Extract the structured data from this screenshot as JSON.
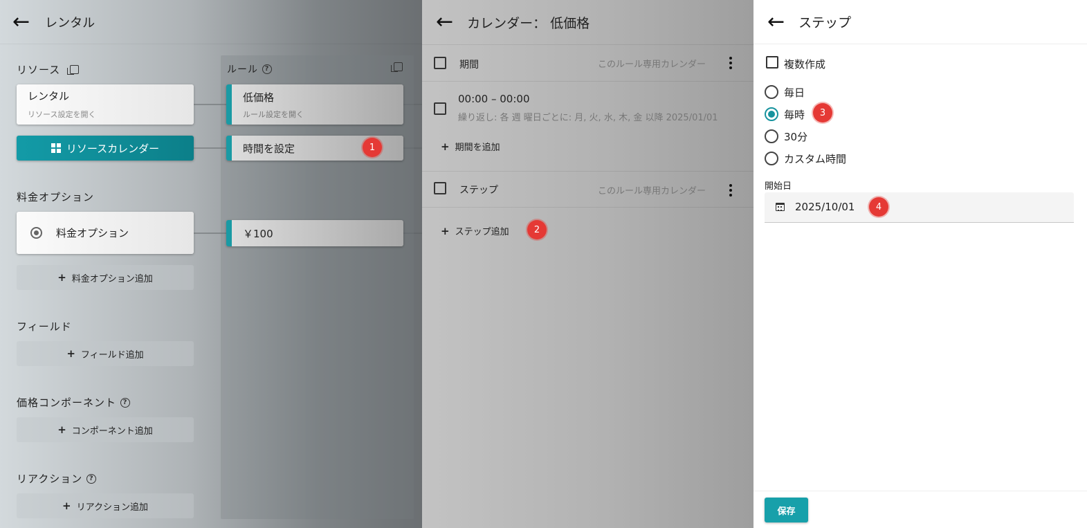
{
  "left": {
    "title": "レンタル",
    "resource_label": "リソース",
    "resource_card": {
      "title": "レンタル",
      "subtitle": "リソース設定を開く"
    },
    "resource_calendar_button": "リソースカレンダー",
    "price_option_label": "料金オプション",
    "price_option_card": "料金オプション",
    "price_option_add": "料金オプション追加",
    "field_label": "フィールド",
    "field_add": "フィールド追加",
    "component_label": "価格コンポーネント",
    "component_add": "コンポーネント追加",
    "reaction_label": "リアクション",
    "reaction_add": "リアクション追加",
    "rules_label": "ルール",
    "rule_card": {
      "title": "低価格",
      "subtitle": "ルール設定を開く"
    },
    "time_card": "時間を設定",
    "price_card": "￥100"
  },
  "middle": {
    "title": "カレンダー： 低価格",
    "period_section": {
      "label": "期間",
      "scope": "このルール専用カレンダー"
    },
    "period_item": {
      "time": "00:00 – 00:00",
      "repeat": "繰り返し: 各 週 曜日ごとに: 月, 火, 水, 木, 金 以降 2025/01/01"
    },
    "add_period": "期間を追加",
    "step_section": {
      "label": "ステップ",
      "scope": "このルール専用カレンダー"
    },
    "add_step": "ステップ追加"
  },
  "right": {
    "title": "ステップ",
    "multi_create_label": "複数作成",
    "options": [
      "毎日",
      "毎時",
      "30分",
      "カスタム時間"
    ],
    "selected_option": "毎時",
    "start_date_label": "開始日",
    "start_date_value": "2025/10/01",
    "save_label": "保存"
  },
  "badges": [
    "1",
    "2",
    "3",
    "4"
  ],
  "colors": {
    "accent": "#17a0aa",
    "badge": "#e53935"
  }
}
